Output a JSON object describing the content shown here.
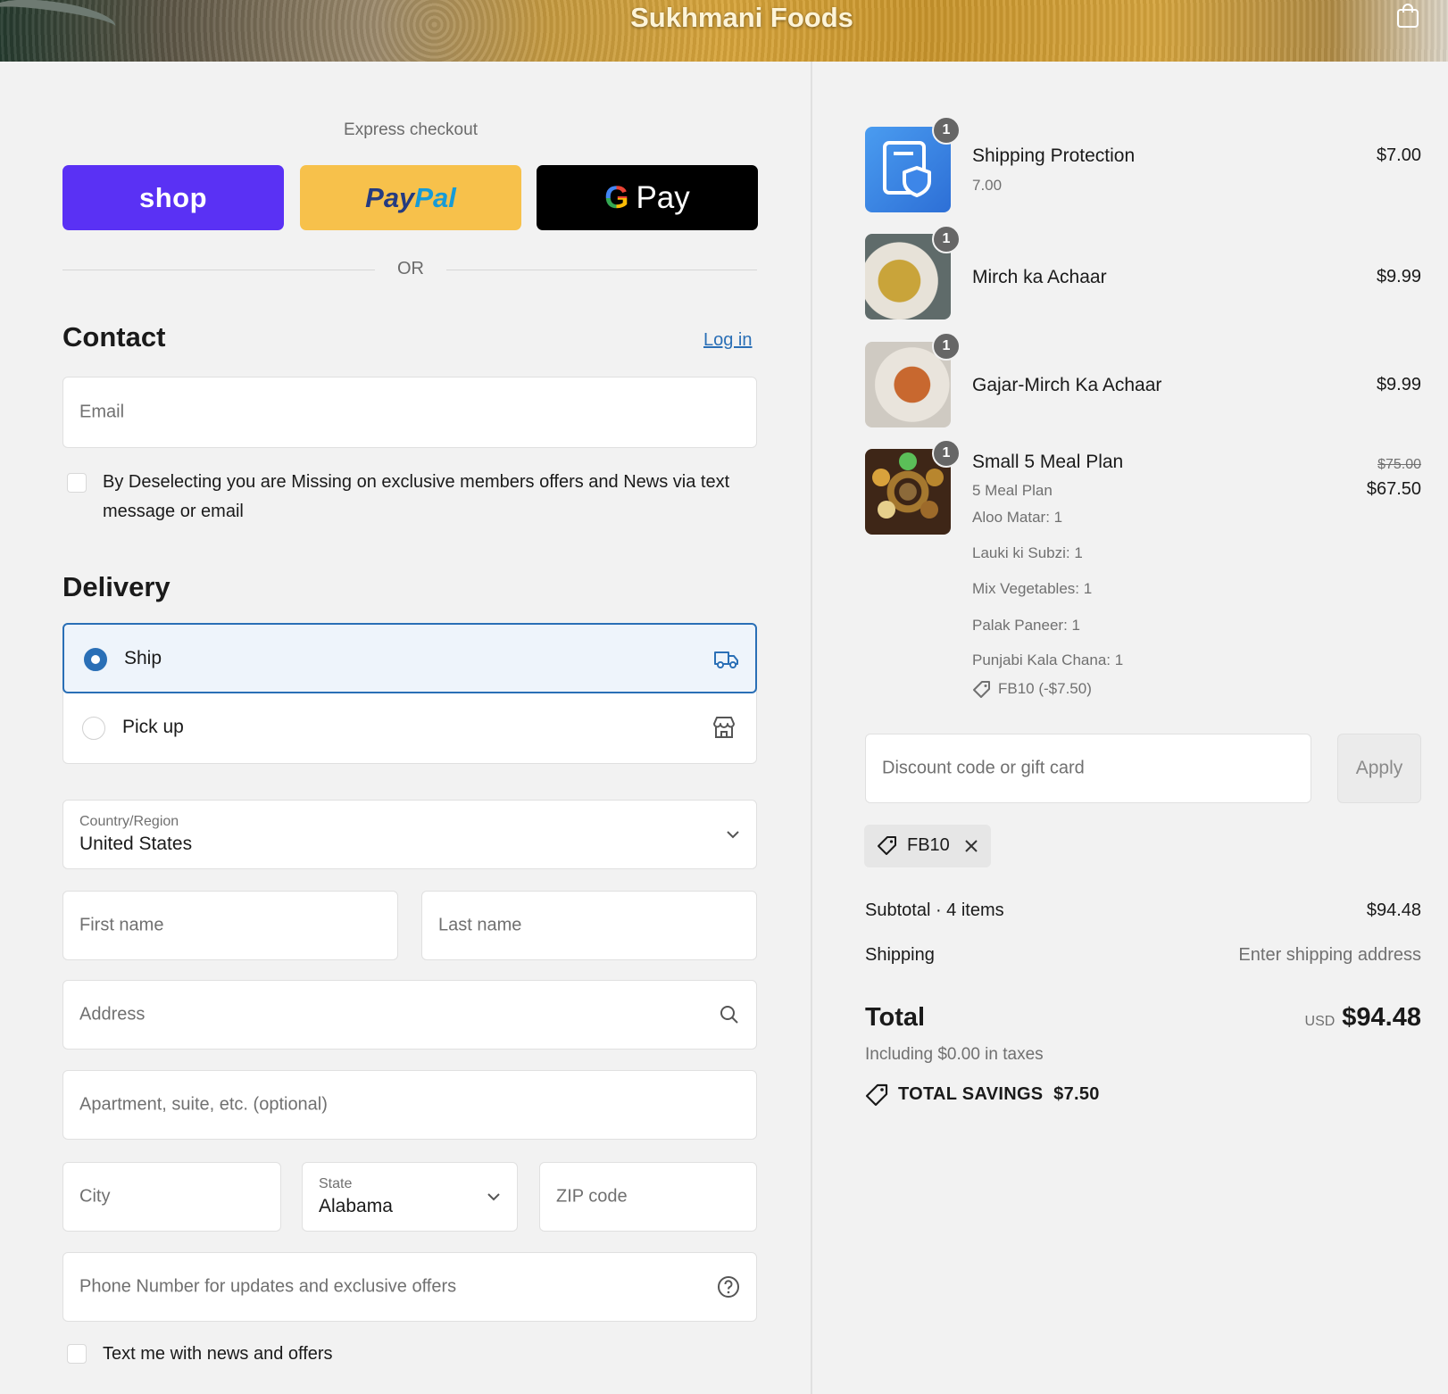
{
  "header": {
    "brand": "Sukhmani Foods"
  },
  "express": {
    "label": "Express checkout",
    "shop_label": "shop",
    "paypal_part1": "Pay",
    "paypal_part2": "Pal",
    "gpay_g": "G",
    "gpay_label": "Pay",
    "or_label": "OR"
  },
  "contact": {
    "heading": "Contact",
    "login_label": "Log in",
    "email_placeholder": "Email",
    "consent_text": "By Deselecting you are Missing on exclusive members offers and News via text message or email"
  },
  "delivery": {
    "heading": "Delivery",
    "options": [
      {
        "label": "Ship",
        "selected": true
      },
      {
        "label": "Pick up",
        "selected": false
      }
    ],
    "country_label": "Country/Region",
    "country_value": "United States",
    "first_name_placeholder": "First name",
    "last_name_placeholder": "Last name",
    "address_placeholder": "Address",
    "apartment_placeholder": "Apartment, suite, etc. (optional)",
    "city_placeholder": "City",
    "state_label": "State",
    "state_value": "Alabama",
    "zip_placeholder": "ZIP code",
    "phone_placeholder": "Phone Number for updates and exclusive offers",
    "text_offers_label": "Text me with news and offers"
  },
  "order": {
    "items": [
      {
        "qty": "1",
        "name": "Shipping Protection",
        "sub": "7.00",
        "price": "$7.00"
      },
      {
        "qty": "1",
        "name": "Mirch ka Achaar",
        "price": "$9.99"
      },
      {
        "qty": "1",
        "name": "Gajar-Mirch Ka Achaar",
        "price": "$9.99"
      },
      {
        "qty": "1",
        "name": "Small 5 Meal Plan",
        "sub": "5 Meal Plan",
        "details": [
          "Aloo Matar: 1",
          "Lauki ki Subzi: 1",
          "Mix Vegetables: 1",
          "Palak Paneer: 1",
          "Punjabi Kala Chana: 1"
        ],
        "discount": "FB10 (-$7.50)",
        "original_price": "$75.00",
        "price": "$67.50"
      }
    ],
    "discount_placeholder": "Discount code or gift card",
    "apply_label": "Apply",
    "applied_code": "FB10",
    "subtotal_label": "Subtotal · 4 items",
    "subtotal_value": "$94.48",
    "shipping_label": "Shipping",
    "shipping_value": "Enter shipping address",
    "total_label": "Total",
    "currency": "USD",
    "total_value": "$94.48",
    "taxes_note": "Including $0.00 in taxes",
    "savings_label": "TOTAL SAVINGS",
    "savings_value": "$7.50"
  },
  "colors": {
    "accent": "#2a6fb6",
    "shop_purple": "#5a31f4",
    "paypal_yellow": "#f7c14b"
  }
}
